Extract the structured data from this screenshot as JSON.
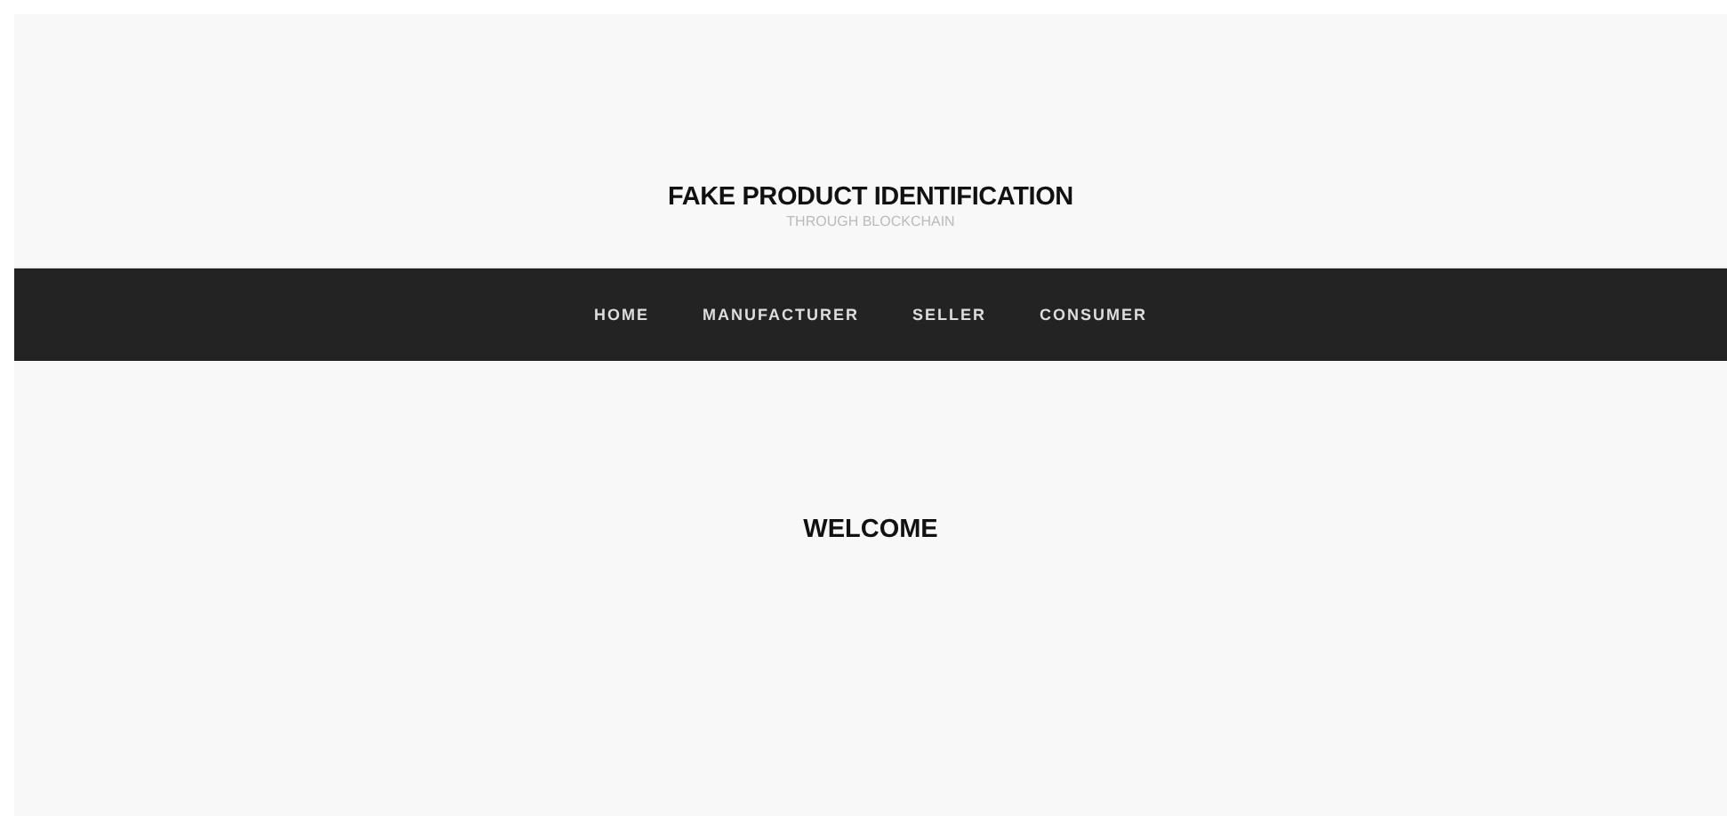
{
  "header": {
    "title": "FAKE PRODUCT IDENTIFICATION",
    "subtitle": "THROUGH BLOCKCHAIN"
  },
  "nav": [
    "HOME",
    "MANUFACTURER",
    "SELLER",
    "CONSUMER"
  ],
  "main": {
    "heading": "WELCOME"
  }
}
